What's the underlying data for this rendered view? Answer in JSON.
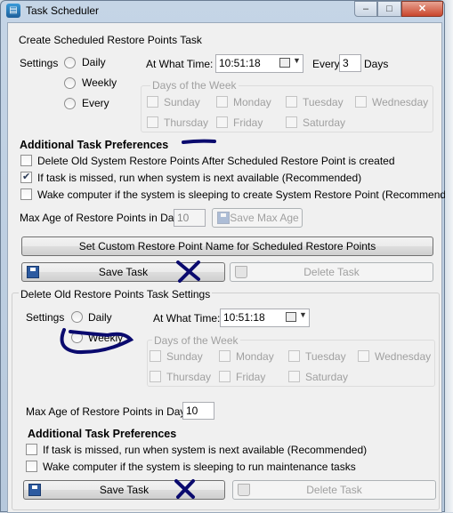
{
  "window": {
    "title": "Task Scheduler",
    "controls": [
      "–",
      "□",
      "✕"
    ]
  },
  "create": {
    "heading": "Create Scheduled Restore Points Task",
    "settings_label": "Settings",
    "options": [
      "Daily",
      "Weekly",
      "Every"
    ],
    "time_label": "At What Time:",
    "time_value": "10:51:18",
    "every_label": "Every",
    "every_value": "3",
    "days_unit": "Days",
    "days_group_label": "Days of the Week",
    "days": [
      "Sunday",
      "Monday",
      "Tuesday",
      "Wednesday",
      "Thursday",
      "Friday",
      "Saturday"
    ],
    "prefs_heading": "Additional Task Preferences",
    "prefs": [
      {
        "label": "Delete Old System Restore Points After Scheduled Restore Point is created",
        "checked": false
      },
      {
        "label": "If task is missed, run when system is next available (Recommended)",
        "checked": true
      },
      {
        "label": "Wake computer if the system is sleeping to create System Restore Point (Recommended)",
        "checked": false
      }
    ],
    "max_age_label": "Max Age of Restore Points in Days:",
    "max_age_value": "10",
    "save_max_age": "Save Max Age",
    "custom_name_button": "Set Custom Restore Point Name for Scheduled Restore Points",
    "save_task": "Save Task",
    "delete_task": "Delete Task"
  },
  "delete_old": {
    "heading": "Delete Old Restore Points Task Settings",
    "settings_label": "Settings",
    "options": [
      "Daily",
      "Weekly"
    ],
    "time_label": "At What Time:",
    "time_value": "10:51:18",
    "days_group_label": "Days of the Week",
    "days": [
      "Sunday",
      "Monday",
      "Tuesday",
      "Wednesday",
      "Thursday",
      "Friday",
      "Saturday"
    ],
    "max_age_label": "Max Age of Restore Points in Days:",
    "max_age_value": "10",
    "prefs_heading": "Additional Task Preferences",
    "prefs": [
      {
        "label": "If task is missed, run when system is next available (Recommended)",
        "checked": false
      },
      {
        "label": "Wake computer if the system is sleeping to run maintenance tasks",
        "checked": false
      }
    ],
    "save_task": "Save Task",
    "delete_task": "Delete Task"
  },
  "colors": {
    "annotation": "#0a0a6e",
    "title_bar": "#c5d5e6",
    "close_button": "#c9452c"
  }
}
